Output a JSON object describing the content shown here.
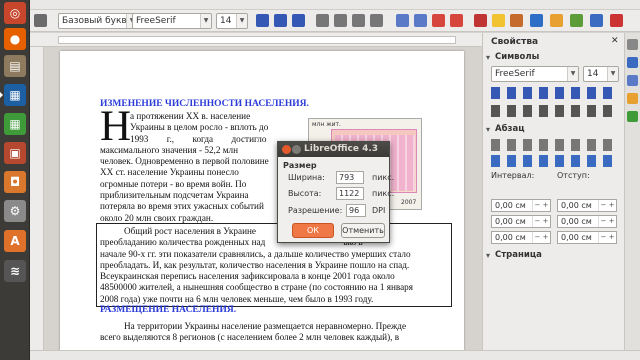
{
  "toolbar": {
    "paragraph_style": "Базовый букв",
    "font_name": "FreeSerif",
    "font_size": "14"
  },
  "document": {
    "heading1": "ИЗМЕНЕНИЕ ЧИСЛЕННОСТИ НАСЕЛЕНИЯ.",
    "dropcap": "Н",
    "para1_lines": [
      "а протяжении XX в. население",
      "Украины в целом росло - вплоть до",
      "1993        г.,        когда        достигло",
      "максимального значения - 52,2 млн",
      "человек. Одновременно в первой половине",
      "XX ст. население Украины понесло",
      "огромные потери - во время войн. По",
      "приблизительным подсчетам Украина",
      "потеряла во время этих ужасных событий",
      "около 20 млн своих граждан."
    ],
    "para2_lines": [
      "Общий рост населения в Украине                                       годаря",
      "преобладанию количества рожденных над                                  ько в",
      "начале 90-х гг. эти показатели сравнялись, а дальше количество умерших стало",
      "преобладать. И, как результат, количество населения в Украине пошло на спад.",
      "Всеукраинская перепись населения зафиксировала в конце 2001 года около",
      "48500000 жителей, а нынешняя сообщество в стране (по состоянию на 1 января",
      "2008 года) уже почти на 6 млн человек меньше, чем было в 1993 году."
    ],
    "heading2": "РАЗМЕЩЕНИЕ НАСЕЛЕНИЯ.",
    "para3_lines": [
      "На территории Украины население размещается неравномерно. Прежде",
      "всего выделяются 8 регионов (с населением более 2 млн человек каждый), в"
    ],
    "chart_caption": "млн жит.",
    "chart_year": "2007"
  },
  "dialog": {
    "title": "LibreOffice 4.3",
    "section": "Размер",
    "width_label": "Ширина:",
    "width_value": "793",
    "height_label": "Высота:",
    "height_value": "1122",
    "resolution_label": "Разрешение:",
    "resolution_value": "96",
    "unit_px": "пикс.",
    "unit_dpi": "DPI",
    "ok_label": "ОК",
    "cancel_label": "Отменить"
  },
  "sidebar": {
    "title": "Свойства",
    "symbols_section": "Символы",
    "font_name": "FreeSerif",
    "font_size": "14",
    "paragraph_section": "Абзац",
    "interval_label": "Интервал:",
    "indent_label": "Отступ:",
    "spin_value": "0,00 см",
    "page_section": "Страница"
  },
  "colors": {
    "heading": "#2a3bd8",
    "dialog_title_bg": "#3b3a37",
    "ok_button": "#f07746",
    "launcher_bg": "#3c3b37"
  }
}
